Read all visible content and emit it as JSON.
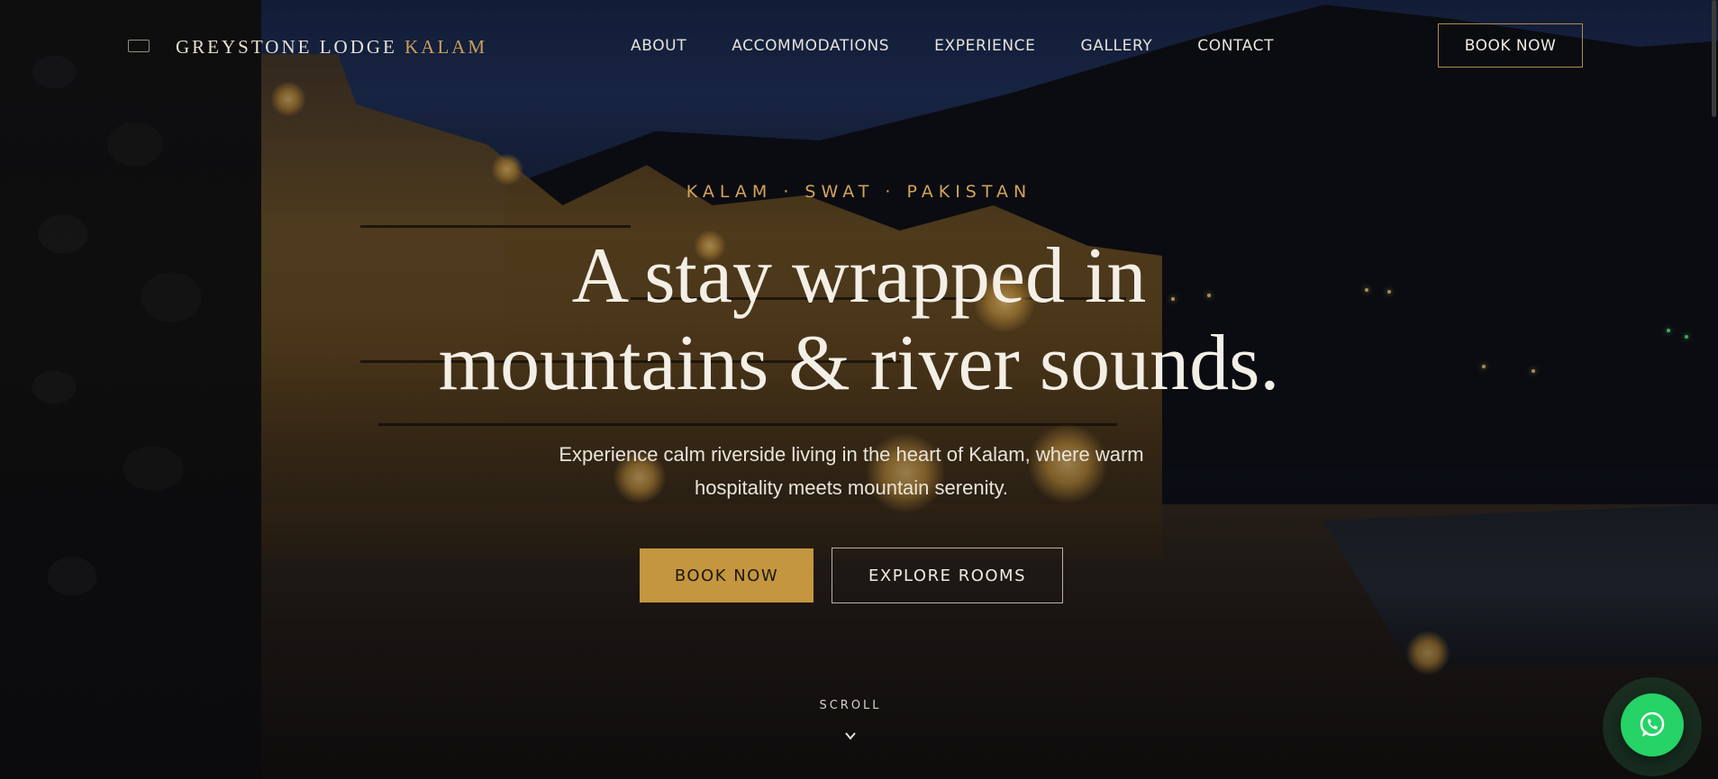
{
  "nav": {
    "logo_main": "GREYSTONE LODGE",
    "logo_accent": "KALAM",
    "links": [
      "ABOUT",
      "ACCOMMODATIONS",
      "EXPERIENCE",
      "GALLERY",
      "CONTACT"
    ],
    "book_label": "BOOK NOW"
  },
  "hero": {
    "eyebrow": "KALAM · SWAT · PAKISTAN",
    "headline_line1": "A stay wrapped in",
    "headline_line2": "mountains & river sounds.",
    "subtext": "Experience calm riverside living in the heart of Kalam, where warm hospitality meets mountain serenity.",
    "primary_cta": "BOOK NOW",
    "secondary_cta": "EXPLORE ROOMS",
    "scroll_label": "SCROLL"
  },
  "icons": {
    "scroll": "chevron-down-icon",
    "chat": "whatsapp-icon",
    "logo": "lodge-logo-icon"
  },
  "colors": {
    "accent": "#c4963f",
    "eyebrow": "#d4a25a",
    "whatsapp": "#25d366"
  }
}
